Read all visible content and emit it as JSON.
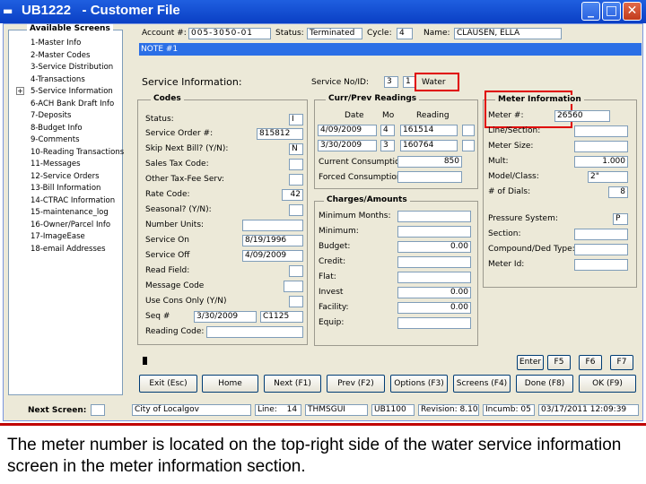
{
  "window": {
    "title": "UB1222   - Customer File",
    "minimize": "_",
    "maximize": "□",
    "close": "✕"
  },
  "tree": {
    "title": "Available Screens",
    "items": [
      "1-Master Info",
      "2-Master Codes",
      "3-Service Distribution",
      "4-Transactions",
      "5-Service Information",
      "6-ACH Bank Draft Info",
      "7-Deposits",
      "8-Budget Info",
      "9-Comments",
      "10-Reading Transactions",
      "11-Messages",
      "12-Service Orders",
      "13-Bill Information",
      "14-CTRAC Information",
      "15-maintenance_log",
      "16-Owner/Parcel Info",
      "17-ImageEase",
      "18-email Addresses"
    ]
  },
  "header": {
    "account_label": "Account #:",
    "account_value": "005-3050-01",
    "status_label": "Status:",
    "status_value": "Terminated",
    "cycle_label": "Cycle:",
    "cycle_value": "4",
    "name_label": "Name:",
    "name_value": "CLAUSEN, ELLA",
    "note": "NOTE #1"
  },
  "service": {
    "title": "Service Information:",
    "no_id_label": "Service No/ID:",
    "no_value": "3",
    "id_value": "1",
    "service_name": "Water"
  },
  "codes": {
    "title": "Codes",
    "rows": [
      {
        "label": "Status:",
        "value": "I"
      },
      {
        "label": "Service Order #:",
        "value": "815812"
      },
      {
        "label": "Skip Next Bill? (Y/N):",
        "value": "N"
      },
      {
        "label": "Sales Tax Code:",
        "value": ""
      },
      {
        "label": "Other Tax-Fee Serv:",
        "value": ""
      },
      {
        "label": "Rate Code:",
        "value": "42"
      },
      {
        "label": "Seasonal? (Y/N):",
        "value": ""
      },
      {
        "label": "Number Units:",
        "value": ""
      },
      {
        "label": "Service On",
        "value": "8/19/1996"
      },
      {
        "label": "Service Off",
        "value": "4/09/2009"
      },
      {
        "label": "Read Field:",
        "value": ""
      },
      {
        "label": "Message Code",
        "value": ""
      },
      {
        "label": "Use Cons Only (Y/N)",
        "value": ""
      },
      {
        "label": "Seq #",
        "value": "3/30/2009",
        "value2": "C1125"
      },
      {
        "label": "Reading Code:",
        "value": ""
      }
    ]
  },
  "readings": {
    "title": "Curr/Prev Readings",
    "col_date": "Date",
    "col_mo": "Mo",
    "col_reading": "Reading",
    "rows": [
      {
        "date": "4/09/2009",
        "mo": "4",
        "reading": "161514"
      },
      {
        "date": "3/30/2009",
        "mo": "3",
        "reading": "160764"
      }
    ],
    "current_label": "Current Consumption:",
    "current_value": "850",
    "forced_label": "Forced Consumption:",
    "forced_value": ""
  },
  "charges": {
    "title": "Charges/Amounts",
    "rows": [
      {
        "label": "Minimum Months:",
        "value": ""
      },
      {
        "label": "Minimum:",
        "value": ""
      },
      {
        "label": "Budget:",
        "value": "0.00"
      },
      {
        "label": "Credit:",
        "value": ""
      },
      {
        "label": "Flat:",
        "value": ""
      },
      {
        "label": "Invest",
        "value": "0.00"
      },
      {
        "label": "Facility:",
        "value": "0.00"
      },
      {
        "label": "Equip:",
        "value": ""
      }
    ]
  },
  "meter": {
    "title": "Meter Information",
    "rows": [
      {
        "label": "Meter #:",
        "value": "26560"
      },
      {
        "label": "Line/Section:",
        "value": ""
      },
      {
        "label": "Meter Size:",
        "value": ""
      },
      {
        "label": "Mult:",
        "value": "1.000"
      },
      {
        "label": "Model/Class:",
        "value": "2\""
      },
      {
        "label": "# of Dials:",
        "value": "8"
      },
      {
        "label": "Pressure System:",
        "value": "P"
      },
      {
        "label": "Section:",
        "value": ""
      },
      {
        "label": "Compound/Ded Type:",
        "value": ""
      },
      {
        "label": "Meter Id:",
        "value": ""
      }
    ]
  },
  "small_buttons": [
    "Enter",
    "F5",
    "F6",
    "F7"
  ],
  "buttons": [
    "Exit (Esc)",
    "Home",
    "Next (F1)",
    "Prev (F2)",
    "Options (F3)",
    "Screens (F4)",
    "Done (F8)",
    "OK (F9)"
  ],
  "statusbar": {
    "next_screen": "Next Screen:",
    "city": "City of Localgov",
    "line_label": "Line:",
    "line_value": "14",
    "user": "THMSGUI",
    "program": "UB1100",
    "revision": "Revision: 8.10",
    "incumb": "Incumb: 05",
    "datetime": "03/17/2011 12:09:39"
  },
  "caption": "The meter number is located on the top-right side of the water service information screen in the meter information section.",
  "colors": {
    "titlebar": "#0a3fc4",
    "highlight": "#e00000",
    "note_bar": "#2b6fe6",
    "face": "#ece9d8"
  }
}
